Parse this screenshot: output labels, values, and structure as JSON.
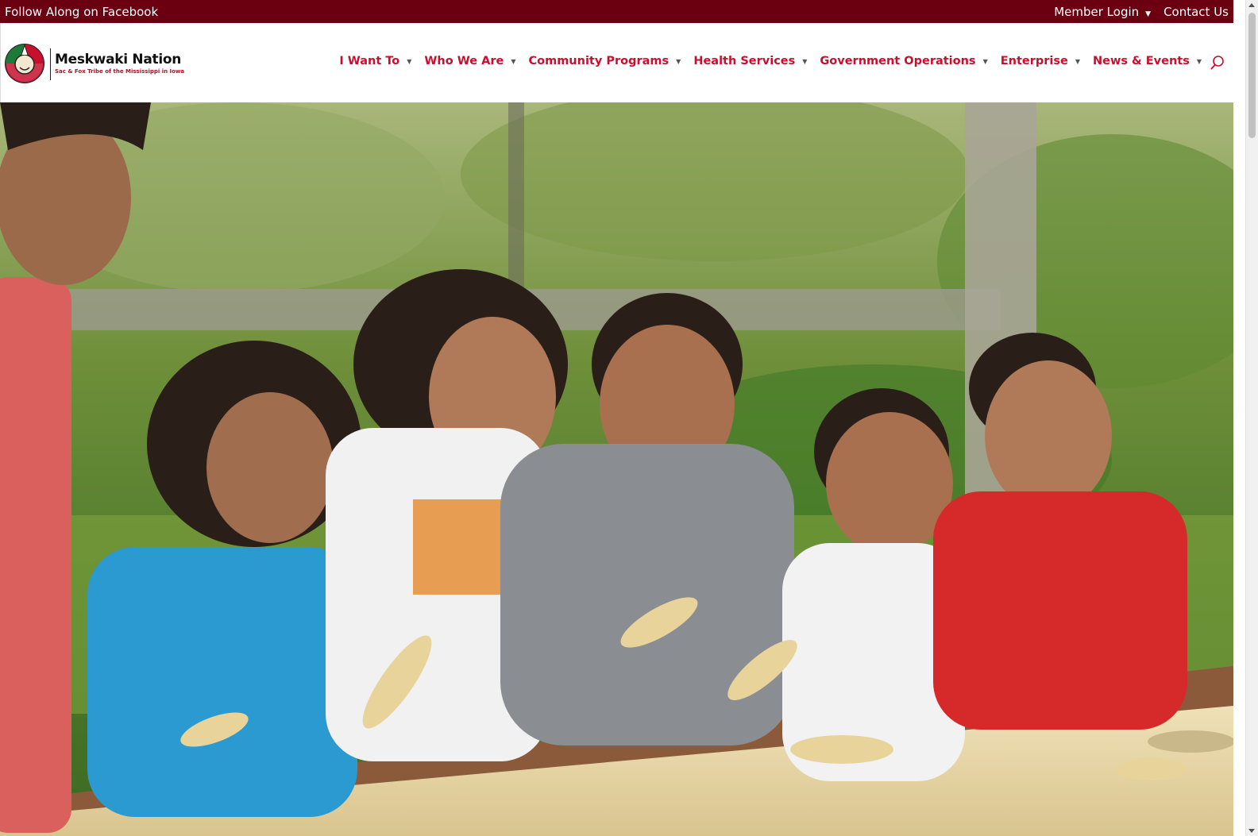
{
  "topbar": {
    "facebook_link": "Follow Along on Facebook",
    "member_login": "Member Login",
    "contact_us": "Contact Us"
  },
  "logo": {
    "name": "Meskwaki Nation",
    "tagline": "Sac & Fox Tribe of the Mississippi in Iowa"
  },
  "nav": {
    "items": [
      {
        "label": "I Want To"
      },
      {
        "label": "Who We Are"
      },
      {
        "label": "Community Programs"
      },
      {
        "label": "Health Services"
      },
      {
        "label": "Government Operations"
      },
      {
        "label": "Enterprise"
      },
      {
        "label": "News & Events"
      }
    ]
  },
  "icons": {
    "search": "search-icon",
    "dropdown": "caret-down-icon"
  },
  "colors": {
    "topbar_bg": "#6a0010",
    "nav_text": "#c8102e",
    "logo_green": "#1e7a3a",
    "logo_red": "#c8102e"
  },
  "hero": {
    "image": "children-shelling-corn-photo"
  }
}
